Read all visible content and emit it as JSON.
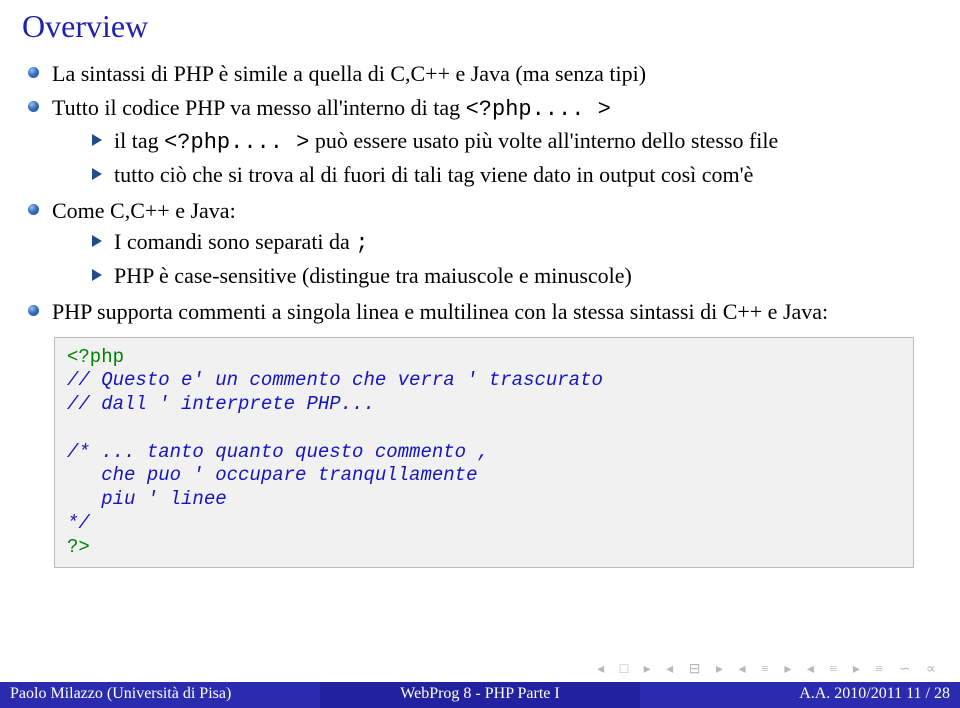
{
  "title": "Overview",
  "bullets": {
    "b1": "La sintassi di PHP è simile a quella di C,C++ e Java (ma senza tipi)",
    "b2": "Tutto il codice PHP va messo all'interno di tag ",
    "b2code": "<?php.... >",
    "t1": "il tag ",
    "t1code": "<?php.... >",
    "t1rest": " può essere usato più volte all'interno dello stesso file",
    "t2": "tutto ciò che si trova al di fuori di tali tag viene dato in output così com'è",
    "b3": "Come C,C++ e Java:",
    "t3": "I comandi sono separati da ",
    "t3code": ";",
    "t4": "PHP è case-sensitive (distingue tra maiuscole e minuscole)",
    "b4": "PHP supporta commenti a singola linea e multilinea con la stessa sintassi di C++ e Java:"
  },
  "code": {
    "l1a": "<?php",
    "l2": "// Questo e' un commento che verra ' trascurato",
    "l3": "// dall ' interprete PHP...",
    "l4": "/* ... tanto quanto questo commento ,",
    "l5": "   che puo ' occupare tranqullamente",
    "l6": "   piu ' linee",
    "l7": "*/",
    "l8": "?>"
  },
  "footer": {
    "left": "Paolo Milazzo (Università di Pisa)",
    "center": "WebProg 8 - PHP Parte I",
    "right": "A.A. 2010/2011    11 / 28"
  }
}
